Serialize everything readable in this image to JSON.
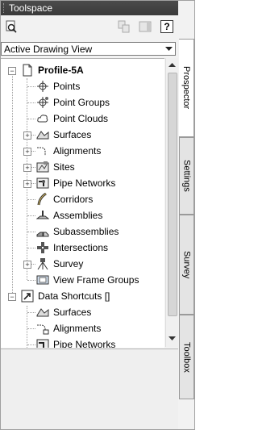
{
  "window": {
    "title": "Toolspace"
  },
  "toolbar": {
    "buttons": [
      "inspect-icon",
      "copy-icon",
      "panel-icon",
      "help-icon"
    ],
    "help_label": "?"
  },
  "view_select": {
    "value": "Active Drawing View"
  },
  "tree": {
    "root": {
      "label": "Profile-5A"
    },
    "items": [
      {
        "label": "Points",
        "icon": "points-icon"
      },
      {
        "label": "Point Groups",
        "icon": "point-groups-icon"
      },
      {
        "label": "Point Clouds",
        "icon": "point-clouds-icon"
      },
      {
        "label": "Surfaces",
        "icon": "surfaces-icon",
        "expandable": true
      },
      {
        "label": "Alignments",
        "icon": "alignments-icon",
        "expandable": true
      },
      {
        "label": "Sites",
        "icon": "sites-icon",
        "expandable": true
      },
      {
        "label": "Pipe Networks",
        "icon": "pipe-networks-icon",
        "expandable": true
      },
      {
        "label": "Corridors",
        "icon": "corridors-icon"
      },
      {
        "label": "Assemblies",
        "icon": "assemblies-icon"
      },
      {
        "label": "Subassemblies",
        "icon": "subassemblies-icon"
      },
      {
        "label": "Intersections",
        "icon": "intersections-icon"
      },
      {
        "label": "Survey",
        "icon": "survey-icon",
        "expandable": true
      },
      {
        "label": "View Frame Groups",
        "icon": "view-frame-groups-icon"
      }
    ],
    "shortcuts": {
      "label": "Data Shortcuts []",
      "items": [
        {
          "label": "Surfaces",
          "icon": "shortcut-surfaces-icon"
        },
        {
          "label": "Alignments",
          "icon": "shortcut-alignments-icon"
        },
        {
          "label": "Pipe Networks",
          "icon": "shortcut-pipe-networks-icon"
        }
      ]
    }
  },
  "tabs": [
    {
      "label": "Prospector",
      "active": true
    },
    {
      "label": "Settings",
      "active": false
    },
    {
      "label": "Survey",
      "active": false
    },
    {
      "label": "Toolbox",
      "active": false
    }
  ],
  "colors": {
    "titlebar": "#3f3f3f",
    "panel": "#f2f2f2",
    "tree_bg": "#ffffff"
  }
}
